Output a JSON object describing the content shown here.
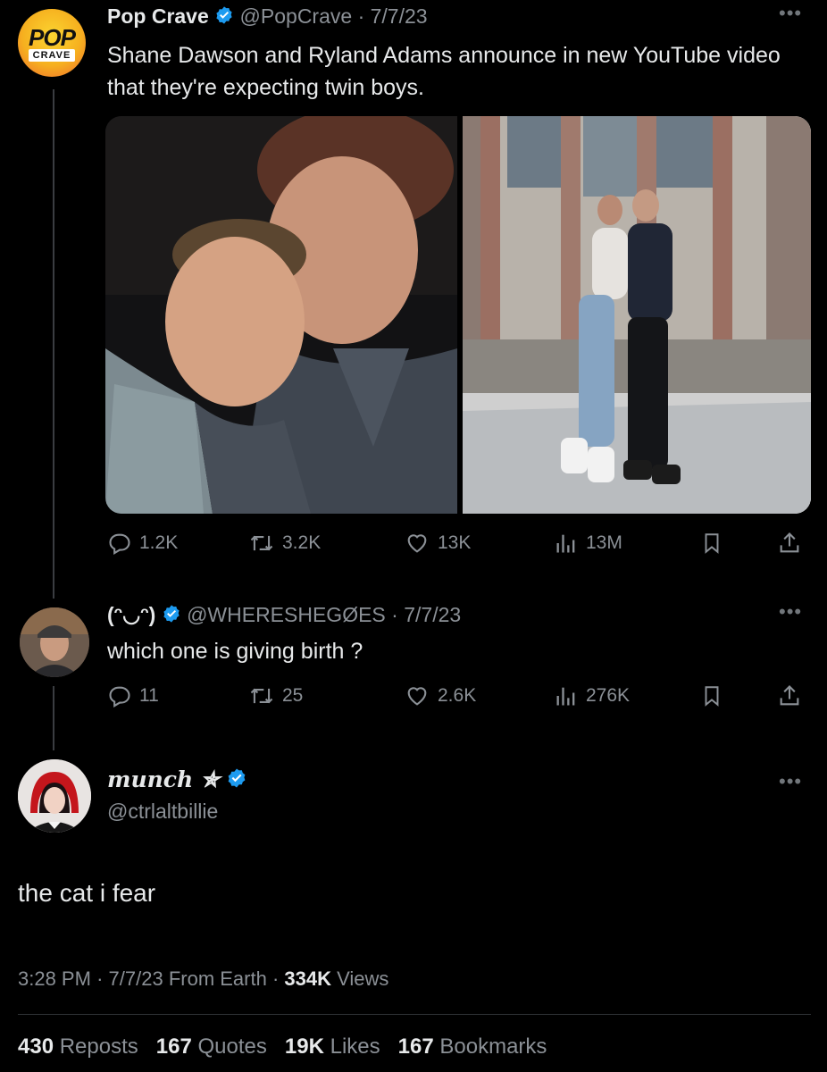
{
  "tweet1": {
    "author": "Pop Crave",
    "handle": "@PopCrave",
    "date": "7/7/23",
    "avatar_line1": "POP",
    "avatar_line2": "CRAVE",
    "text": "Shane Dawson and Ryland Adams announce in new YouTube video that they're expecting twin boys.",
    "replies": "1.2K",
    "reposts": "3.2K",
    "likes": "13K",
    "views": "13M"
  },
  "tweet2": {
    "author": "(ᵔ◡ᵔ)",
    "handle": "@WHERESHEGØES",
    "date": "7/7/23",
    "text": "which one is giving birth ?",
    "replies": "11",
    "reposts": "25",
    "likes": "2.6K",
    "views": "276K"
  },
  "tweet3": {
    "author": "munch ✯",
    "handle": "@ctrlaltbillie",
    "text": "the cat i fear",
    "time": "3:28 PM",
    "date": "7/7/23",
    "source": "From Earth",
    "views_count": "334K",
    "views_label": "Views",
    "reposts_count": "430",
    "reposts_label": "Reposts",
    "quotes_count": "167",
    "quotes_label": "Quotes",
    "likes_count": "19K",
    "likes_label": "Likes",
    "bookmarks_count": "167",
    "bookmarks_label": "Bookmarks"
  },
  "separator": "·",
  "colors": {
    "background": "#000000",
    "verified": "#1d9bf0",
    "muted": "#8b9096",
    "popcrave_yellow": "#f6c21c",
    "popcrave_orange": "#f26a2a"
  }
}
